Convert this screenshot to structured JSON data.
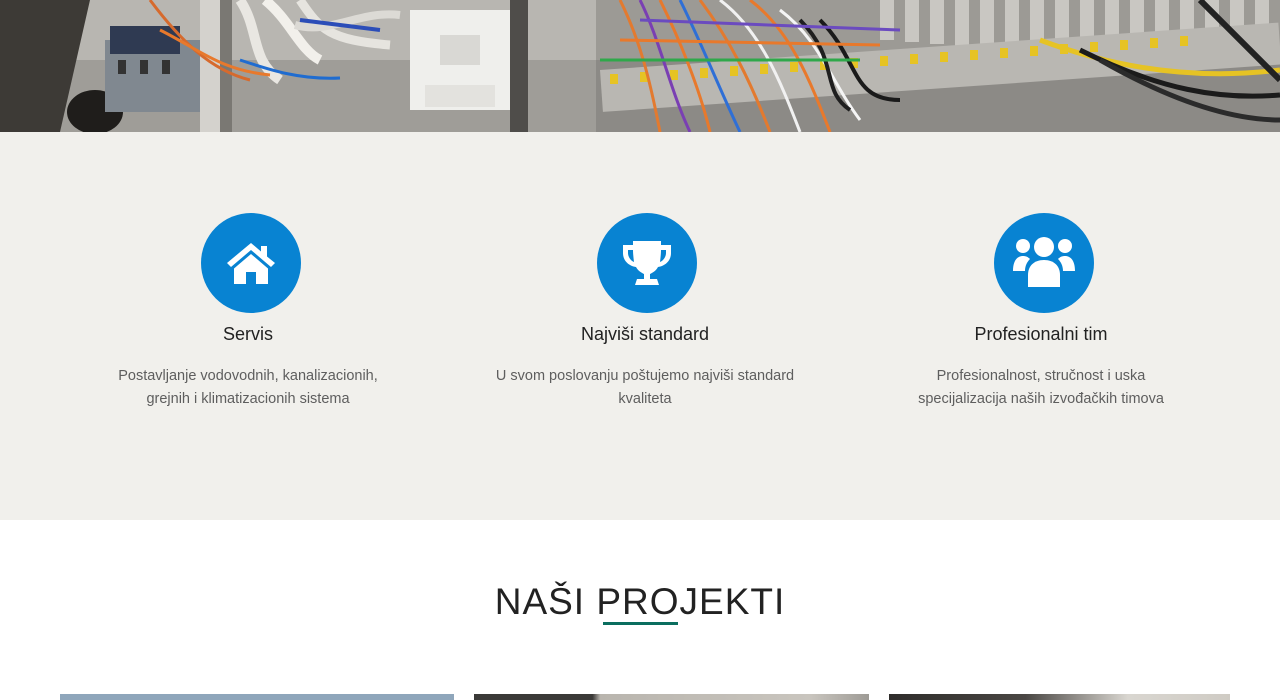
{
  "hero": {
    "image": "electrical-cabinet-photo"
  },
  "features": [
    {
      "icon": "home-icon",
      "title": "Servis",
      "text": "Postavljanje vodovodnih, kanalizacionih, grejnih i klimatizacionih sistema"
    },
    {
      "icon": "trophy-icon",
      "title": "Najviši standard",
      "text": "U svom poslovanju poštujemo najviši standard kvaliteta"
    },
    {
      "icon": "users-icon",
      "title": "Profesionalni tim",
      "text": "Profesionalnost, stručnost i uska specijalizacija naših izvođačkih timova"
    }
  ],
  "projects": {
    "title": "NAŠI PROJEKTI"
  },
  "colors": {
    "accent": "#0883d2",
    "underline": "#0b6e5f",
    "section_bg": "#f1f0ec"
  }
}
